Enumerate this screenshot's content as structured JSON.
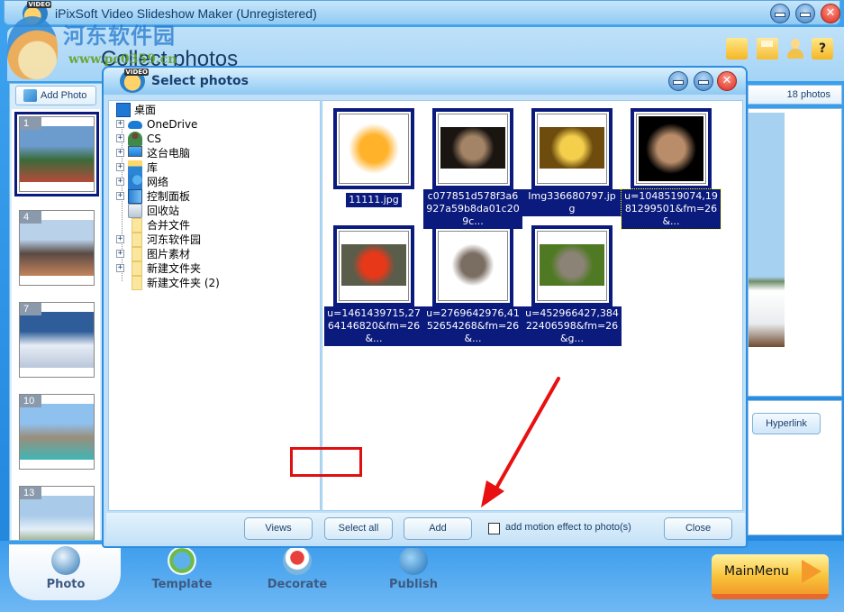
{
  "app": {
    "title": "iPixSoft Video Slideshow Maker (Unregistered)",
    "logo_tag": "VIDEO",
    "page_title": "Collect photos",
    "watermark_text": "河东软件园",
    "watermark_url": "www.pc0359.cn"
  },
  "left_panel": {
    "add_photo_label": "Add Photo",
    "thumbnails": [
      {
        "number": "1",
        "selected": true,
        "colors": [
          "#6c9ccd",
          "#3a6b3a",
          "#b54a3a"
        ]
      },
      {
        "number": "4",
        "selected": false,
        "colors": [
          "#b9d2ea",
          "#5a4a44",
          "#c3845b"
        ]
      },
      {
        "number": "7",
        "selected": false,
        "colors": [
          "#2f5d9a",
          "#e7edf5",
          "#b9c6da"
        ]
      },
      {
        "number": "10",
        "selected": false,
        "colors": [
          "#8fc1ef",
          "#9a8e7c",
          "#3fb6b5"
        ]
      },
      {
        "number": "13",
        "selected": false,
        "colors": [
          "#a9cbe9",
          "#e3eef7",
          "#5d7b3a"
        ]
      }
    ]
  },
  "right_panel": {
    "photos_count": "18 photos",
    "hyperlink_label": "Hyperlink"
  },
  "dialog": {
    "title": "Select photos",
    "logo_tag": "VIDEO",
    "tree": [
      {
        "label": "桌面",
        "icon": "desktop-icon",
        "expandable": false,
        "root": true
      },
      {
        "label": "OneDrive",
        "icon": "cloud-icon",
        "expandable": true
      },
      {
        "label": "CS",
        "icon": "user-icon",
        "expandable": true
      },
      {
        "label": "这台电脑",
        "icon": "computer-icon",
        "expandable": true
      },
      {
        "label": "库",
        "icon": "library-icon",
        "expandable": true
      },
      {
        "label": "网络",
        "icon": "network-icon",
        "expandable": true
      },
      {
        "label": "控制面板",
        "icon": "control-panel-icon",
        "expandable": true
      },
      {
        "label": "回收站",
        "icon": "recycle-bin-icon",
        "expandable": false
      },
      {
        "label": "合并文件",
        "icon": "folder-icon",
        "expandable": false
      },
      {
        "label": "河东软件园",
        "icon": "folder-icon",
        "expandable": true
      },
      {
        "label": "图片素材",
        "icon": "folder-icon",
        "expandable": true
      },
      {
        "label": "新建文件夹",
        "icon": "folder-icon",
        "expandable": true
      },
      {
        "label": "新建文件夹 (2)",
        "icon": "folder-icon",
        "expandable": false
      }
    ],
    "photos": [
      {
        "caption": "11111.jpg",
        "subject": "sun drawing",
        "colors": [
          "#ffffff",
          "#ffb22a"
        ],
        "focused": false
      },
      {
        "caption": "c077851d578f3a6927a59b8da01c209c...",
        "subject": "kitten",
        "colors": [
          "#1b1512",
          "#a38466"
        ],
        "focused": false
      },
      {
        "caption": "Img336680797.jpg",
        "subject": "duckling",
        "colors": [
          "#6d4c0e",
          "#f4cf4c"
        ],
        "focused": false
      },
      {
        "caption": "u=1048519074,1981299501&fm=26&...",
        "subject": "cheetah cub",
        "colors": [
          "#000000",
          "#b98d6a"
        ],
        "focused": true
      },
      {
        "caption": "u=1461439715,2764146820&fm=26&...",
        "subject": "golden pheasant",
        "colors": [
          "#5a5d4a",
          "#e8381a"
        ],
        "focused": false
      },
      {
        "caption": "u=2769642976,4152654268&fm=26&...",
        "subject": "two kittens",
        "colors": [
          "#ffffff",
          "#7a6d62"
        ],
        "focused": false
      },
      {
        "caption": "u=452966427,38422406598&fm=26&g...",
        "subject": "squirrel",
        "colors": [
          "#4f7a23",
          "#8c8377"
        ],
        "focused": false
      }
    ],
    "buttons": {
      "views": "Views",
      "select_all": "Select all",
      "add": "Add",
      "close": "Close"
    },
    "motion_checkbox": {
      "label": "add motion effect to photo(s)",
      "checked": false
    }
  },
  "nav": {
    "tabs": [
      {
        "label": "Photo",
        "active": true
      },
      {
        "label": "Template",
        "active": false
      },
      {
        "label": "Decorate",
        "active": false
      },
      {
        "label": "Publish",
        "active": false
      }
    ],
    "main_menu_label": "MainMenu"
  },
  "colors": {
    "accent_blue": "#2b8ce0",
    "selection_navy": "#0b1a7d",
    "highlight_red": "#e01010"
  }
}
